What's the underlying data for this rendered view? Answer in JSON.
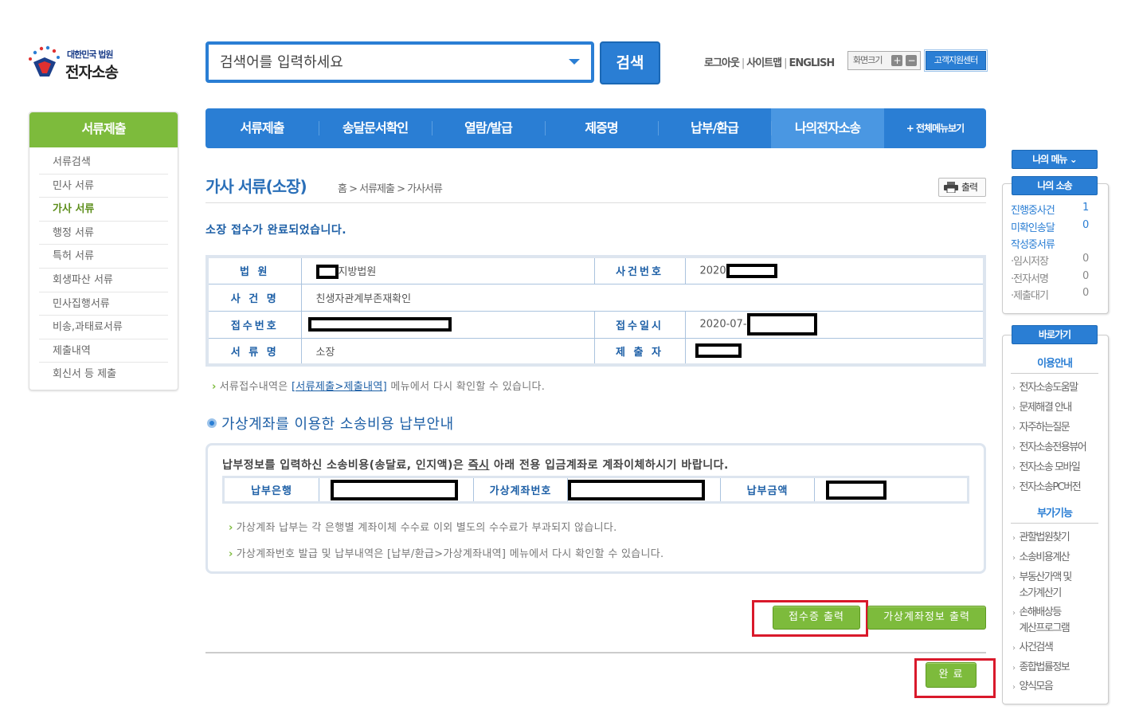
{
  "logo": {
    "subtitle": "대한민국 법원",
    "title": "전자소송"
  },
  "search": {
    "placeholder": "검색어를 입력하세요",
    "button": "검색"
  },
  "top_links": {
    "logout": "로그아웃",
    "sitemap": "사이트맵",
    "english": "ENGLISH",
    "zoom": "화면크기",
    "zoom_in": "+",
    "zoom_out": "−",
    "help": "고객지원센터"
  },
  "left_nav": {
    "title": "서류제출",
    "items": [
      "서류검색",
      "민사 서류",
      "가사 서류",
      "행정 서류",
      "특허 서류",
      "회생파산 서류",
      "민사집행서류",
      "비송,과태료서류",
      "제출내역",
      "회신서 등 제출"
    ],
    "active_index": 2
  },
  "main_nav": {
    "items": [
      "서류제출",
      "송달문서확인",
      "열람/발급",
      "제증명",
      "납부/환급",
      "나의전자소송"
    ],
    "active_index": 5,
    "all_menu": "+ 전체메뉴보기"
  },
  "page": {
    "title": "가사 서류(소장)",
    "breadcrumb": "홈 > 서류제출 > 가사서류",
    "print": "출력",
    "done_message": "소장 접수가 완료되었습니다."
  },
  "info": {
    "court_label": "법 원",
    "court_value": "지방법원",
    "case_no_label": "사건번호",
    "case_no_value": "2020",
    "case_name_label": "사 건 명",
    "case_name_value": "친생자관계부존재확인",
    "receipt_no_label": "접수번호",
    "receipt_date_label": "접수일시",
    "receipt_date_value": "2020-07-",
    "doc_name_label": "서 류 명",
    "doc_name_value": "소장",
    "submitter_label": "제 출 자"
  },
  "note1": {
    "prefix": "서류접수내역은 ",
    "link": "[서류제출>제출내역]",
    "suffix": " 메뉴에서 다시 확인할 수 있습니다."
  },
  "payment": {
    "section_title": "가상계좌를 이용한 소송비용 납부안내",
    "message_prefix": "납부정보를 입력하신 소송비용(송달료, 인지액)은 ",
    "message_emph": "즉시",
    "message_suffix": " 아래 전용 입금계좌로 계좌이체하시기 바랍니다.",
    "bank_label": "납부은행",
    "account_label": "가상계좌번호",
    "amount_label": "납부금액",
    "note1": "가상계좌 납부는 각 은행별 계좌이체 수수료 이외 별도의 수수료가 부과되지 않습니다.",
    "note2": "가상계좌번호 발급 및 납부내역은 [납부/환급>가상계좌내역] 메뉴에서 다시 확인할 수 있습니다."
  },
  "buttons": {
    "receipt_print": "접수증 출력",
    "account_print": "가상계좌정보 출력",
    "complete": "완 료"
  },
  "right_sidebar": {
    "my_menu": "나의 메뉴",
    "my_case": "나의 소송",
    "my_items": [
      {
        "label": "진행중사건",
        "count": "1"
      },
      {
        "label": "미확인송달",
        "count": "0"
      },
      {
        "label": "작성중서류",
        "count": ""
      },
      {
        "label": "·임시저장",
        "count": "0"
      },
      {
        "label": "·전자서명",
        "count": "0"
      },
      {
        "label": "·제출대기",
        "count": "0"
      }
    ],
    "shortcut": "바로가기",
    "guide_title": "이용안내",
    "guide_items": [
      "전자소송도움말",
      "문제해결 안내",
      "자주하는질문",
      "전자소송전용뷰어",
      "전자소송 모바일",
      "전자소송PC버전"
    ],
    "extra_title": "부가기능",
    "extra_items": [
      "관할법원찾기",
      "소송비용계산",
      "부동산가액 및",
      "소가계산기",
      "손해배상등",
      "계산프로그램",
      "사건검색",
      "종합법률정보",
      "양식모음"
    ]
  },
  "colors": {
    "primary": "#2a7ed4",
    "green": "#7dbb3c",
    "highlight": "#d9192b"
  }
}
